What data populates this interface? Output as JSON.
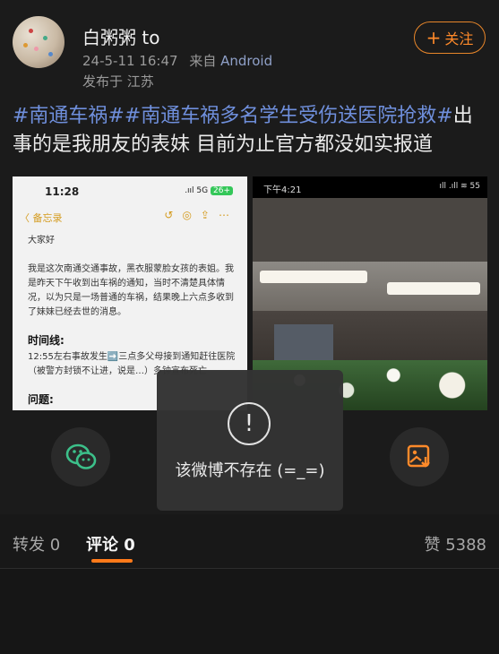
{
  "user": {
    "name": "白粥粥 to",
    "time": "24-5-11 16:47",
    "from_label": "来自",
    "device": "Android",
    "location": "发布于 江苏",
    "follow_label": "关注"
  },
  "post": {
    "tags": [
      "#南通车祸#",
      "#南通车祸多名学生受伤送医院抢救#"
    ],
    "text": "出事的是我朋友的表妹 目前为止官方都没如实报道"
  },
  "image1": {
    "status_time": "11:28",
    "status_right": ".ııl 5G",
    "battery": "26+",
    "back_label": "〈 备忘录",
    "greeting": "大家好",
    "para1": "我是这次南通交通事故，黑衣服蒙脸女孩的表姐。我是昨天下午收到出车祸的通知，当时不清楚具体情况，以为只是一场普通的车祸，结果晚上六点多收到了妹妹已经去世的消息。",
    "heading1": "时间线:",
    "para2": "12:55左右事故发生➡️三点多父母接到通知赶往医院（被警方封锁不让进，说是…）多钟宣布死亡",
    "heading2": "问题:"
  },
  "image2": {
    "status_time": "下午4:21",
    "status_right": "ıll .ıll ≋ 55"
  },
  "toast": {
    "icon": "exclamation-icon",
    "message": "该微博不存在 (=_=)"
  },
  "tabs": {
    "repost": "转发 0",
    "comment": "评论 0",
    "likes": "赞 5388"
  },
  "colors": {
    "accent": "#ff7a1a",
    "tag": "#6f8fdc",
    "wechat": "#3cc08a"
  }
}
